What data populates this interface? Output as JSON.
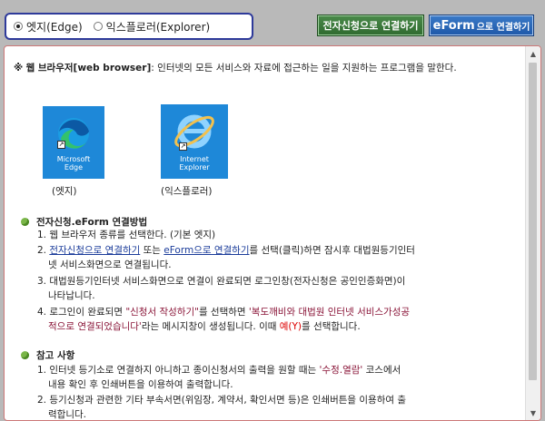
{
  "browser_select": {
    "options": [
      {
        "label": "엣지(Edge)",
        "checked": true
      },
      {
        "label": "익스플로러(Explorer)",
        "checked": false
      }
    ]
  },
  "buttons": {
    "epetition": "전자신청으로 연결하기",
    "eform_big": "eForm",
    "eform_rest": "으로 연결하기"
  },
  "intro": {
    "mark": "※",
    "term": "웹 브라우저[web browser]",
    "text": ": 인터넷의 모든 서비스와 자료에 접근하는 일을 지원하는 프로그램을 말한다."
  },
  "icons": {
    "edge_line1": "Microsoft",
    "edge_line2": "Edge",
    "edge_caption": "(엣지)",
    "ie_line1": "Internet",
    "ie_line2": "Explorer",
    "ie_caption": "(익스플로러)"
  },
  "section1": {
    "title": "전자신청.eForm 연결방법",
    "l1": "1. 웹 브라우저 종류를 선택한다. (기본 엣지)",
    "l2_a": "2. ",
    "l2_link1": "전자신청으로 연결하기",
    "l2_b": " 또는 ",
    "l2_link2": "eForm으로 연결하기",
    "l2_c": "를 선택(클릭)하면 잠시후 대법원등기인터",
    "l2_d": "넷 서비스화면으로 연결됩니다.",
    "l3_a": "3. 대법원등기인터넷 서비스화면으로 연결이 완료되면 로그인창(전자신청은 공인인증화면)이",
    "l3_b": "나타납니다.",
    "l4_a": "4. 로그인이 완료되면 ",
    "l4_q1": "\"신청서 작성하기\"",
    "l4_b": "를 선택하면 ",
    "l4_q2": "'복도깨비와 대법원 인터넷 서비스가성공",
    "l4_c": "적으로 연결되었습니다'",
    "l4_d": "라는 메시지창이 생성됩니다. 이때 ",
    "l4_yes": "예(Y)",
    "l4_e": "를 선택합니다."
  },
  "section2": {
    "title": "참고 사항",
    "l1_a": "1. 인터넷 등기소로 연결하지 아니하고 종이신청서의 출력을 원할 때는 ",
    "l1_q": "'수정.열람'",
    "l1_b": " 코스에서",
    "l1_c": "내용 확인 후 인쇄버튼을 이용하여 출력합니다.",
    "l2_a": "2. 등기신청과 관련한 기타 부속서면(위임장, 계약서, 확인서면 등)은 인쇄버튼을 이용하여 출",
    "l2_b": "력합니다."
  },
  "colors": {
    "accent_green": "#7ab648",
    "link_blue": "#1b3c9a",
    "maroon": "#8a1538",
    "red": "#dd0000"
  }
}
